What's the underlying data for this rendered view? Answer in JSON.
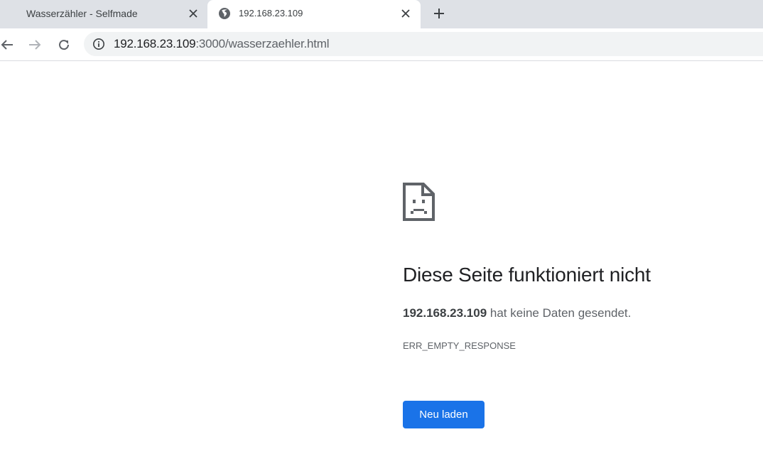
{
  "tabs": [
    {
      "title": "Wasserzähler - Selfmade",
      "active": false
    },
    {
      "title": "192.168.23.109",
      "active": true
    }
  ],
  "toolbar": {
    "url_host": "192.168.23.109",
    "url_rest": ":3000/wasserzaehler.html"
  },
  "error": {
    "heading": "Diese Seite funktioniert nicht",
    "host": "192.168.23.109",
    "summary_suffix": " hat keine Daten gesendet.",
    "code": "ERR_EMPTY_RESPONSE",
    "reload_label": "Neu laden"
  },
  "colors": {
    "tabstrip": "#dee1e6",
    "omnibox": "#f1f3f4",
    "button": "#1a73e8"
  },
  "icons": {
    "tab_close": "close-icon",
    "tab_favicon": "globe-icon",
    "new_tab": "plus-icon",
    "back": "arrow-left-icon",
    "forward": "arrow-right-icon",
    "reload": "reload-icon",
    "site_info": "info-icon",
    "error": "sad-document-icon"
  }
}
